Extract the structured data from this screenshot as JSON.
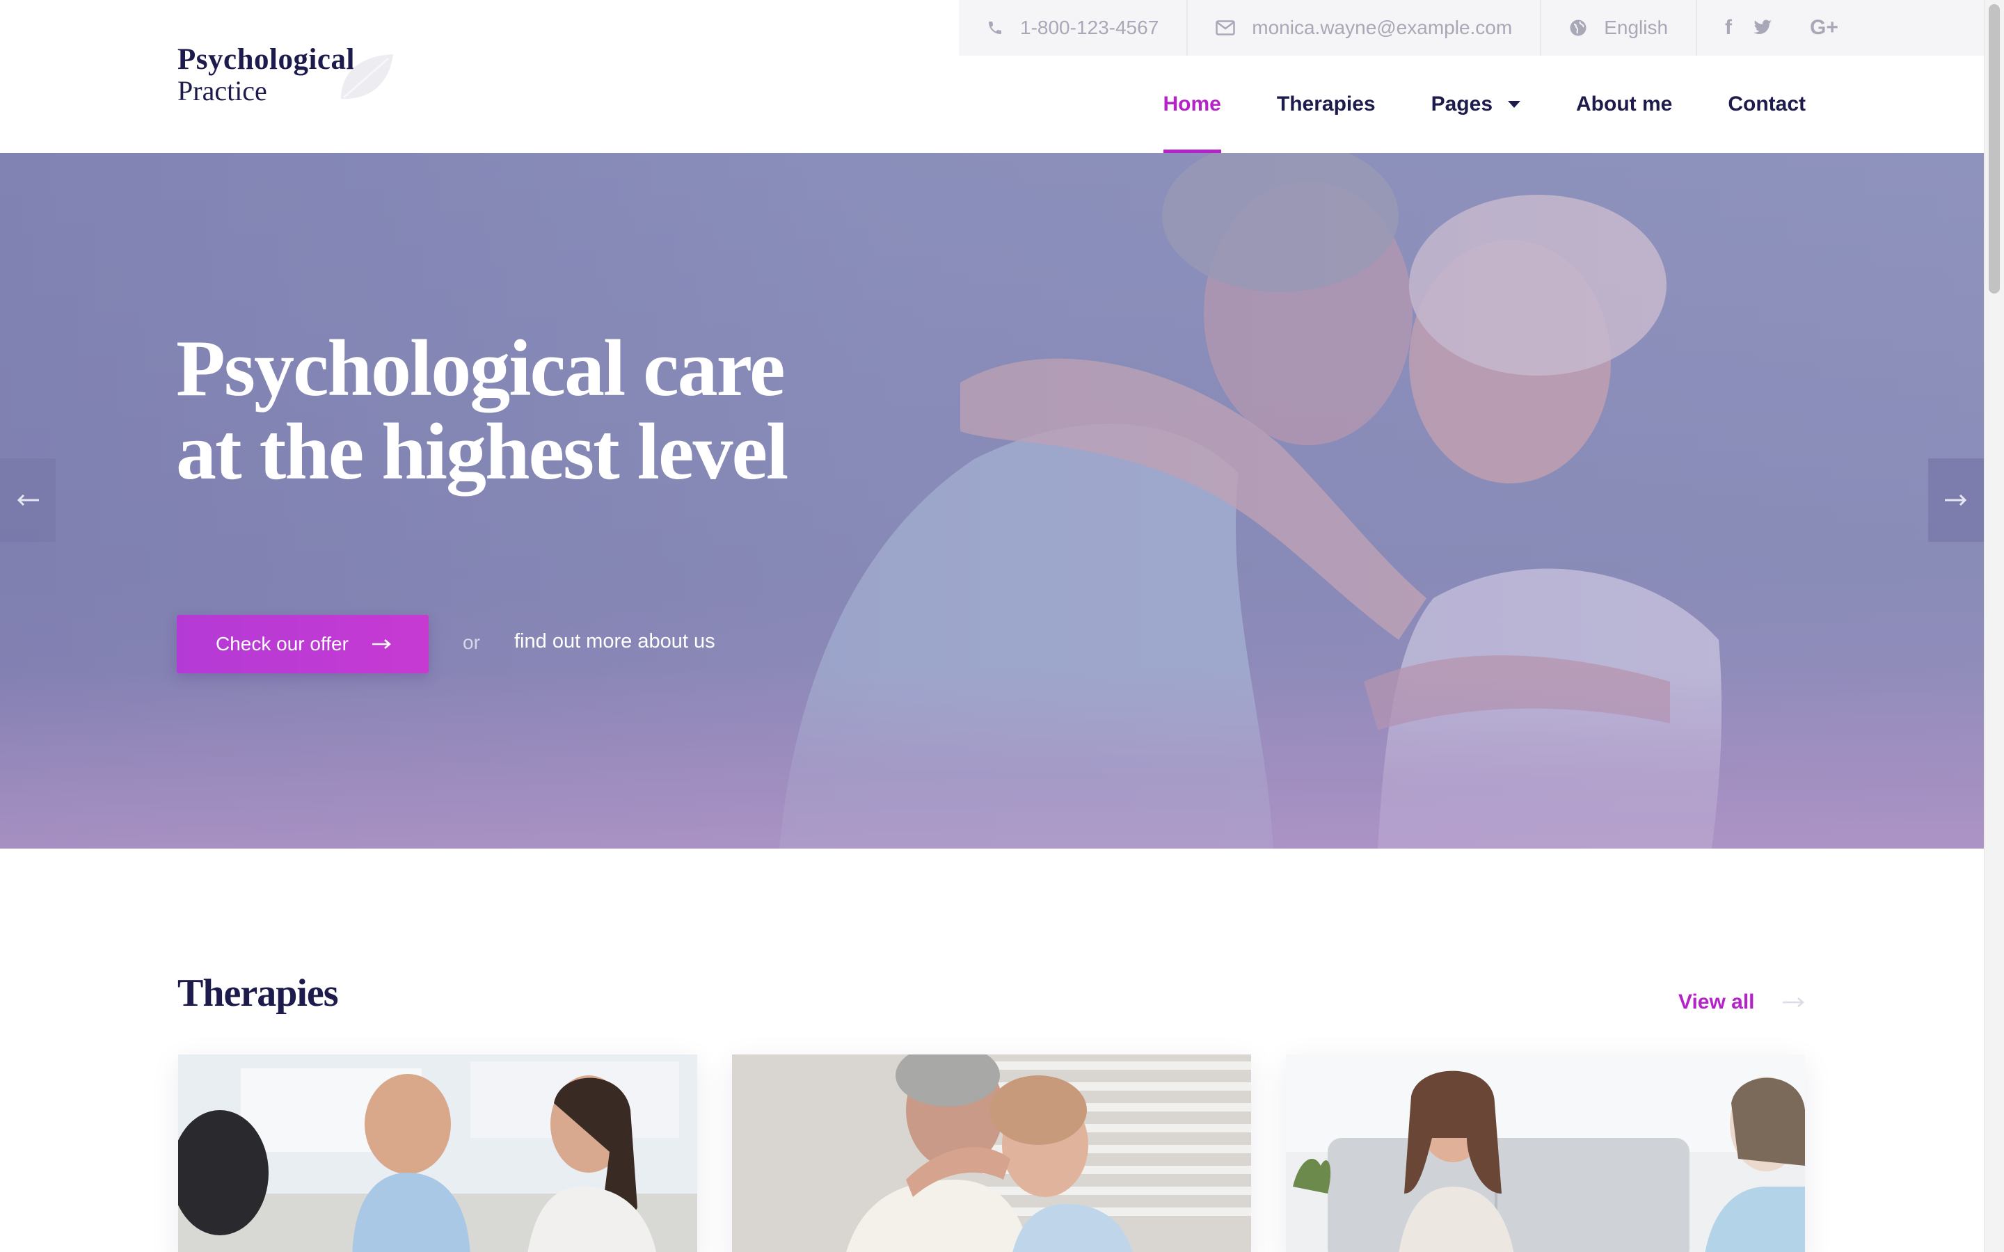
{
  "topbar": {
    "phone": "1-800-123-4567",
    "email": "monica.wayne@example.com",
    "language": "English",
    "social": [
      {
        "name": "facebook-icon",
        "glyph": "f"
      },
      {
        "name": "twitter-icon",
        "glyph": "t"
      },
      {
        "name": "google-plus-icon",
        "glyph": "G+"
      }
    ]
  },
  "logo": {
    "line1": "Psychological",
    "line2": "Practice"
  },
  "nav": {
    "items": [
      {
        "label": "Home",
        "active": true
      },
      {
        "label": "Therapies",
        "active": false
      },
      {
        "label": "Pages",
        "active": false,
        "dropdown": true
      },
      {
        "label": "About me",
        "active": false
      },
      {
        "label": "Contact",
        "active": false
      }
    ]
  },
  "hero": {
    "title_line1": "Psychological care",
    "title_line2": "at the highest level",
    "cta_label": "Check our offer",
    "or_text": "or",
    "more_link": "find out more about us"
  },
  "therapies": {
    "title": "Therapies",
    "view_all": "View all"
  },
  "colors": {
    "accent": "#b422c8",
    "navy": "#1d1b4c",
    "hero_tint": "#8689b5"
  }
}
